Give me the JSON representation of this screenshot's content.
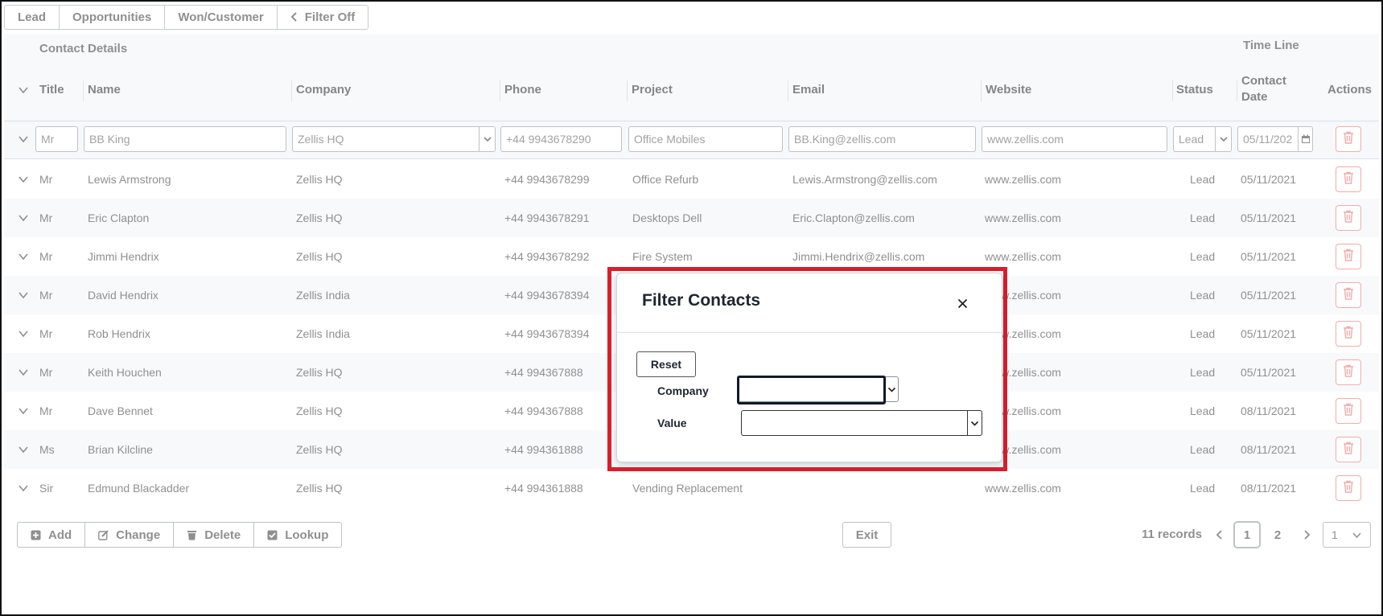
{
  "tabs": [
    "Lead",
    "Opportunities",
    "Won/Customer",
    "Filter Off"
  ],
  "header": {
    "group_contact_details": "Contact Details",
    "group_time_line": "Time Line",
    "columns": {
      "title": "Title",
      "name": "Name",
      "company": "Company",
      "phone": "Phone",
      "project": "Project",
      "email": "Email",
      "website": "Website",
      "status": "Status",
      "contact_date": "Contact Date",
      "actions": "Actions"
    }
  },
  "edit_row": {
    "title": "Mr",
    "name": "BB King",
    "company": "Zellis HQ",
    "phone": "+44 9943678290",
    "project": "Office Mobiles",
    "email": "BB.King@zellis.com",
    "website": "www.zellis.com",
    "status": "Lead",
    "contact_date": "05/11/202"
  },
  "rows": [
    {
      "title": "Mr",
      "name": "Lewis Armstrong",
      "company": "Zellis HQ",
      "phone": "+44 9943678299",
      "project": "Office Refurb",
      "email": "Lewis.Armstrong@zellis.com",
      "website": "www.zellis.com",
      "status": "Lead",
      "date": "05/11/2021"
    },
    {
      "title": "Mr",
      "name": "Eric Clapton",
      "company": "Zellis HQ",
      "phone": "+44 9943678291",
      "project": "Desktops Dell",
      "email": "Eric.Clapton@zellis.com",
      "website": "www.zellis.com",
      "status": "Lead",
      "date": "05/11/2021"
    },
    {
      "title": "Mr",
      "name": "Jimmi Hendrix",
      "company": "Zellis HQ",
      "phone": "+44 9943678292",
      "project": "Fire System",
      "email": "Jimmi.Hendrix@zellis.com",
      "website": "www.zellis.com",
      "status": "Lead",
      "date": "05/11/2021"
    },
    {
      "title": "Mr",
      "name": "David Hendrix",
      "company": "Zellis India",
      "phone": "+44 9943678394",
      "project": "",
      "email": "",
      "website": "www.zellis.com",
      "status": "Lead",
      "date": "05/11/2021"
    },
    {
      "title": "Mr",
      "name": "Rob Hendrix",
      "company": "Zellis India",
      "phone": "+44 9943678394",
      "project": "",
      "email": "",
      "website": "www.zellis.com",
      "status": "Lead",
      "date": "05/11/2021"
    },
    {
      "title": "Mr",
      "name": "Keith Houchen",
      "company": "Zellis HQ",
      "phone": "+44 994367888",
      "project": "",
      "email": "",
      "website": "www.zellis.com",
      "status": "Lead",
      "date": "05/11/2021"
    },
    {
      "title": "Mr",
      "name": "Dave Bennet",
      "company": "Zellis HQ",
      "phone": "+44 994367888",
      "project": "",
      "email": "",
      "website": "www.zellis.com",
      "status": "Lead",
      "date": "08/11/2021"
    },
    {
      "title": "Ms",
      "name": "Brian Kilcline",
      "company": "Zellis HQ",
      "phone": "+44 994361888",
      "project": "",
      "email": "",
      "website": "www.zellis.com",
      "status": "Lead",
      "date": "08/11/2021"
    },
    {
      "title": "Sir",
      "name": "Edmund Blackadder",
      "company": "Zellis HQ",
      "phone": "+44 994361888",
      "project": "Vending Replacement",
      "email": "",
      "website": "www.zellis.com",
      "status": "Lead",
      "date": "08/11/2021"
    }
  ],
  "footer": {
    "add": "Add",
    "change": "Change",
    "delete": "Delete",
    "lookup": "Lookup",
    "exit": "Exit",
    "records": "11 records",
    "pages": [
      "1",
      "2"
    ],
    "page_select": "1"
  },
  "modal": {
    "title": "Filter Contacts",
    "reset": "Reset",
    "company_label": "Company",
    "value_label": "Value"
  },
  "colors": {
    "highlight": "#d81f2c",
    "delete": "#e26b6b",
    "header_bg": "#f3f5f7"
  }
}
